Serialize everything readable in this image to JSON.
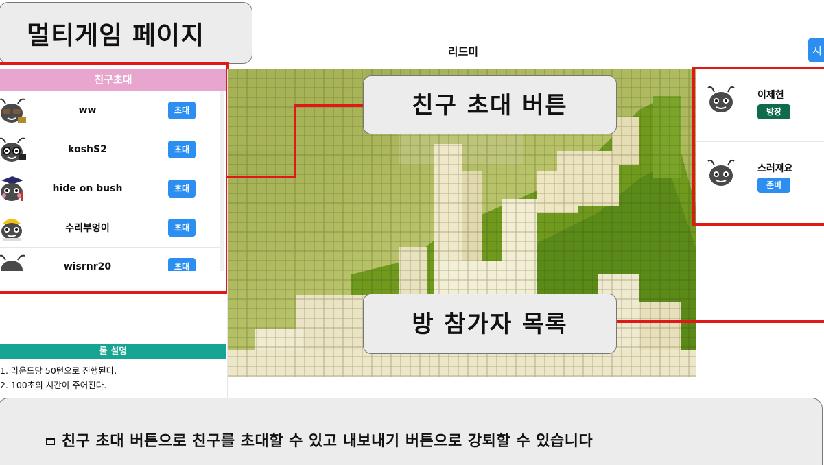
{
  "header": {
    "page_title": "멀티게임 페이지",
    "room_name": "리드미",
    "start_button_partial": "시"
  },
  "friend_panel": {
    "title": "친구초대",
    "friends": [
      {
        "name": "ww",
        "button": "초대",
        "avatar": "ant-sunglasses-icon"
      },
      {
        "name": "koshS2",
        "button": "초대",
        "avatar": "ant-glasses-icon"
      },
      {
        "name": "hide on bush",
        "button": "초대",
        "avatar": "ant-graduate-icon"
      },
      {
        "name": "수리부엉이",
        "button": "초대",
        "avatar": "ant-hardhat-icon"
      },
      {
        "name": "wisrnr20",
        "button": "초대",
        "avatar": "ant-icon"
      }
    ]
  },
  "rules": {
    "title": "룰 설명",
    "lines": [
      "1. 라운드당 50턴으로 진행된다.",
      "2. 100초의 시간이 주어진다."
    ]
  },
  "participants": [
    {
      "name": "이제헌",
      "badge": "방장",
      "badge_color": "#0f6b4d"
    },
    {
      "name": "스러져요",
      "badge": "준비",
      "badge_color": "#2b8ef0"
    }
  ],
  "callouts": {
    "friend_invite": "친구 초대 버튼",
    "participants": "방 참가자 목록"
  },
  "caption": {
    "text": "친구 초대 버튼으로 친구를 초대할 수 있고 내보내기 버튼으로 강퇴할 수 있습니다"
  },
  "colors": {
    "highlight_red": "#e01818",
    "friend_header": "#e8a6cf",
    "rules_header": "#17a493",
    "button_blue": "#2b8ef0"
  }
}
